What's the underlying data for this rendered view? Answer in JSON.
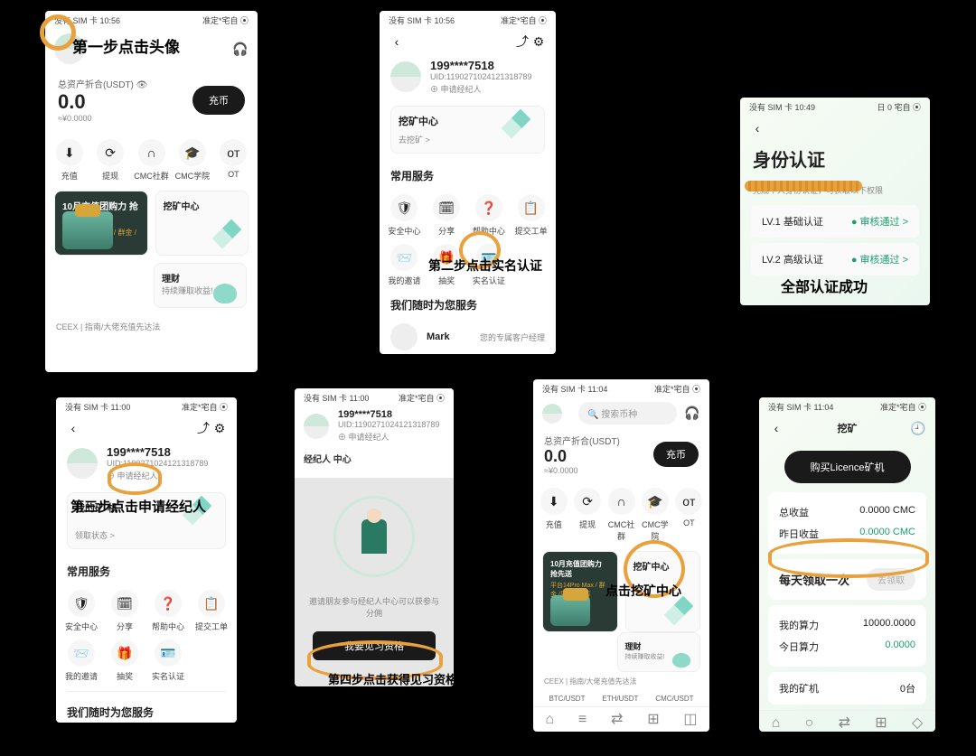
{
  "status_time1": "没有 SIM 卡 10:56",
  "status_right": "准定*宅自 ⦿",
  "status_time2": "没有 SIM 卡 11:00",
  "status_time3": "没有 SIM 卡 10:49",
  "status_time4": "没有 SIM 卡 11:04",
  "step1": "第一步点击头像",
  "step2": "第二步点击实名认证",
  "step3": "第三步点击申请经纪人",
  "step4": "第四步点击获得见习资格",
  "step5": "点击挖矿中心",
  "step_daily": "每天领取一次",
  "step_success": "全部认证成功",
  "assets_label": "总资产折合(USDT) 👁",
  "assets_label2": "总资产折合(USDT)",
  "assets_value": "0.0",
  "assets_fiat": "≈¥0.0000",
  "btn_deposit": "充币",
  "svc": {
    "a": "充值",
    "b": "提现",
    "c": "CMC社群",
    "d": "CMC学院",
    "e": "OT"
  },
  "promo_title": "10月充值团购力 抢先送",
  "promo_sub": "平台14Pro Max / 群金 /周边 / 蓝筹",
  "card_mining": "挖矿中心",
  "card_wealth": "理财",
  "card_wealth_sub": "持续赚取收益!",
  "ceex_line": "CEEX | 指南/大佬充值先达法",
  "phone": "199****7518",
  "uid": "UID:1190271024121318789",
  "broker": "⊕ 申请经纪人",
  "mining_center": "挖矿中心",
  "go_mining": "去挖矿 >",
  "common_services": "常用服务",
  "sv": {
    "a": "安全中心",
    "b": "分享",
    "c": "帮助中心",
    "d": "提交工单",
    "e": "我的邀请",
    "f": "抽奖",
    "g": "实名认证"
  },
  "support_line": "我们随时为您服务",
  "mark": "Mark",
  "mark_sub": "您的专属客户经理",
  "my_mining": "我的矿 机",
  "get_status": "领取状态 >",
  "identity_title": "身份认证",
  "identity_sub": "完成个人身份认证，可获取以下权限",
  "lv1": "LV.1 基础认证",
  "lv2": "LV.2 高级认证",
  "verify_go": "● 审核通过  >",
  "broker_center": "经纪人 中心",
  "broker_desc": "邀请朋友参与经纪人中心可以获参与分佣",
  "btn_get_trainee": "我要见习资格",
  "mining_title": "挖矿",
  "btn_license": "购买Licence矿机",
  "total_income": "总收益",
  "v1": "0.0000 CMC",
  "yesterday": "昨日收益",
  "v2": "0.0000 CMC",
  "daily_get": "每天领取一次",
  "btn_claim": "去领取",
  "my_power": "我的算力",
  "v3": "10000.0000",
  "today_power": "今日算力",
  "v4": "0.0000",
  "my_miner": "我的矿机",
  "v5": "0台",
  "pair1": "BTC/USDT",
  "pair2": "ETH/USDT",
  "pair3": "CMC/USDT"
}
